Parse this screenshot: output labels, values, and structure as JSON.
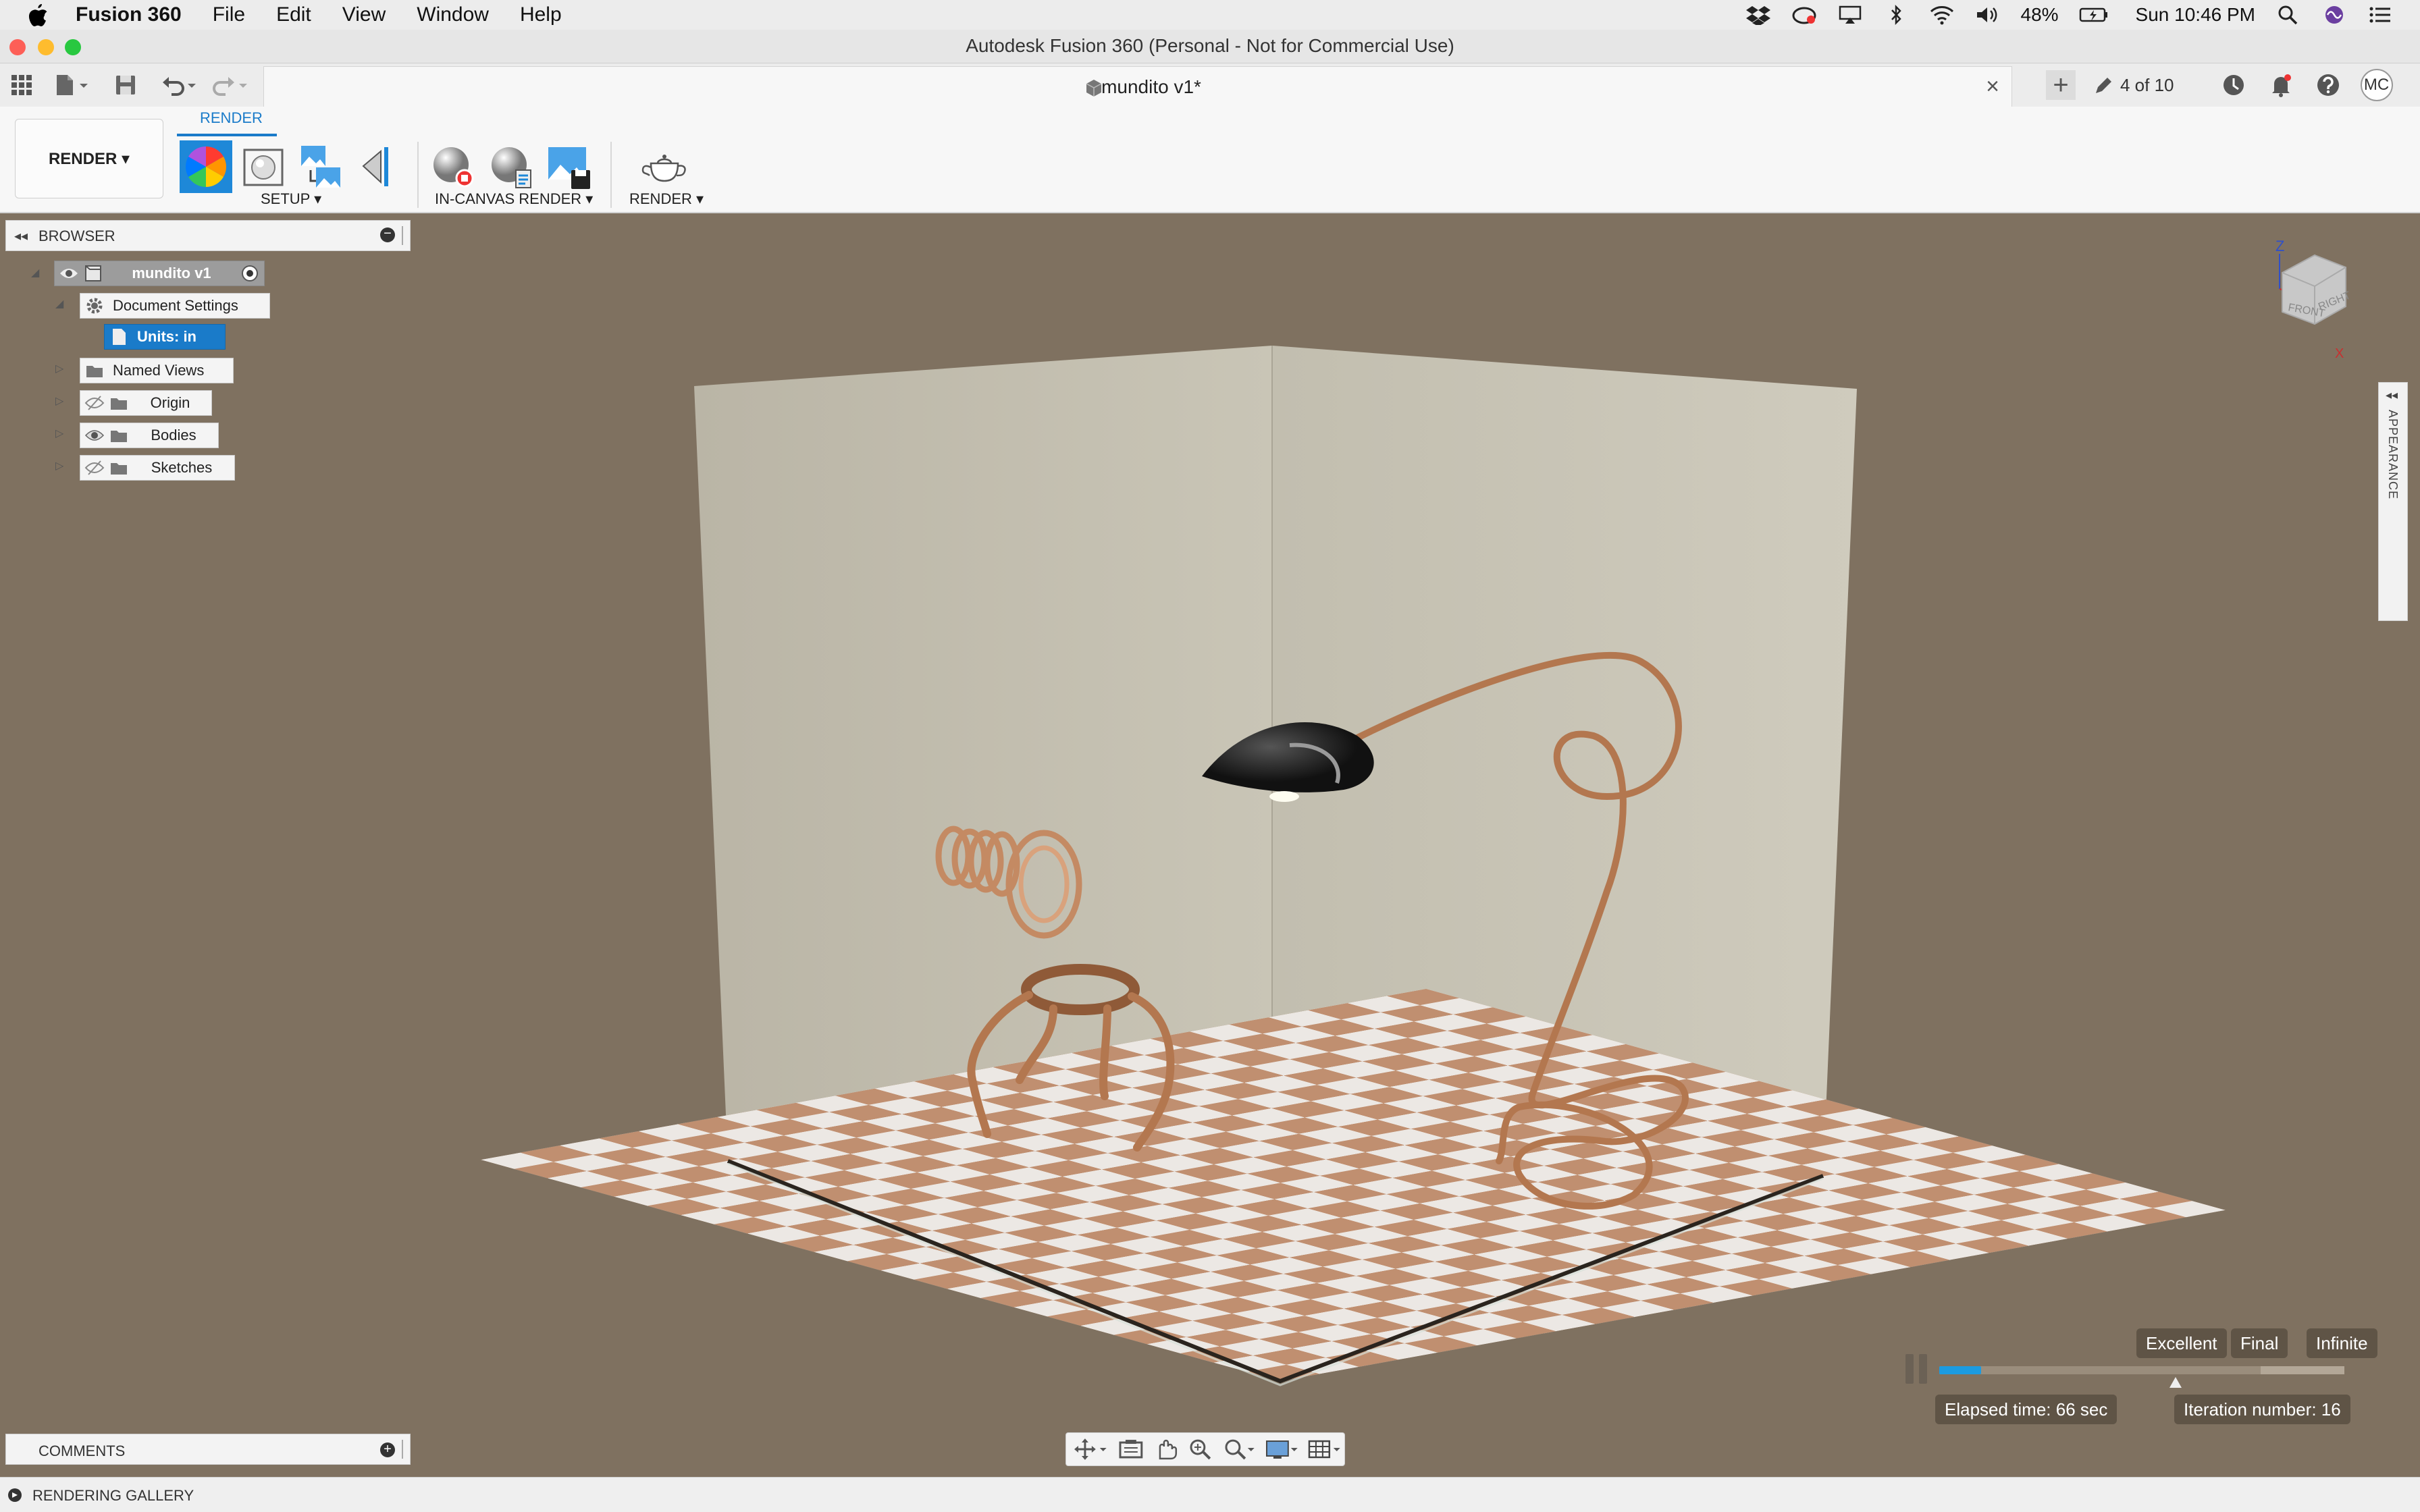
{
  "menubar": {
    "items": [
      "Fusion 360",
      "File",
      "Edit",
      "View",
      "Window",
      "Help"
    ],
    "battery": "48%",
    "clock": "Sun 10:46 PM"
  },
  "window": {
    "title": "Autodesk Fusion 360 (Personal - Not for Commercial Use)"
  },
  "tabbar": {
    "document_tab": "mundito v1*",
    "close_glyph": "×",
    "add_glyph": "+",
    "version_counter": "4 of 10",
    "avatar_initials": "MC"
  },
  "ribbon": {
    "workspace": "RENDER ▾",
    "active_tab": "RENDER",
    "groups": {
      "setup": "SETUP ▾",
      "in_canvas": "IN-CANVAS RENDER ▾",
      "render": "RENDER ▾"
    }
  },
  "browser": {
    "title": "BROWSER",
    "collapse_glyph": "◂◂",
    "minus_glyph": "−",
    "root": "mundito v1",
    "document_settings": "Document Settings",
    "units": "Units: in",
    "folders": [
      "Named Views",
      "Origin",
      "Bodies",
      "Sketches"
    ]
  },
  "viewcube": {
    "faces": [
      "FRONT",
      "RIGHT"
    ],
    "axes": [
      "Z",
      "X"
    ]
  },
  "appearance_panel": {
    "label": "APPEARANCE",
    "arrow": "◂◂"
  },
  "render_progress": {
    "quality_levels": [
      "Excellent",
      "Final",
      "Infinite"
    ],
    "elapsed": "Elapsed time: 66 sec",
    "iteration": "Iteration number: 16",
    "progress": 0.103,
    "marker": 0.583
  },
  "comments": {
    "title": "COMMENTS",
    "plus_glyph": "+"
  },
  "gallery": {
    "title": "RENDERING GALLERY"
  },
  "colors": {
    "canvas_bg": "#7f7160",
    "accent_blue": "#1a7bc9",
    "progress_blue": "#1c9be0",
    "copper": "#b87a55",
    "wall": "#c7c3b4",
    "tile_light": "#ece8e4",
    "tile_copper": "#c08f70"
  }
}
